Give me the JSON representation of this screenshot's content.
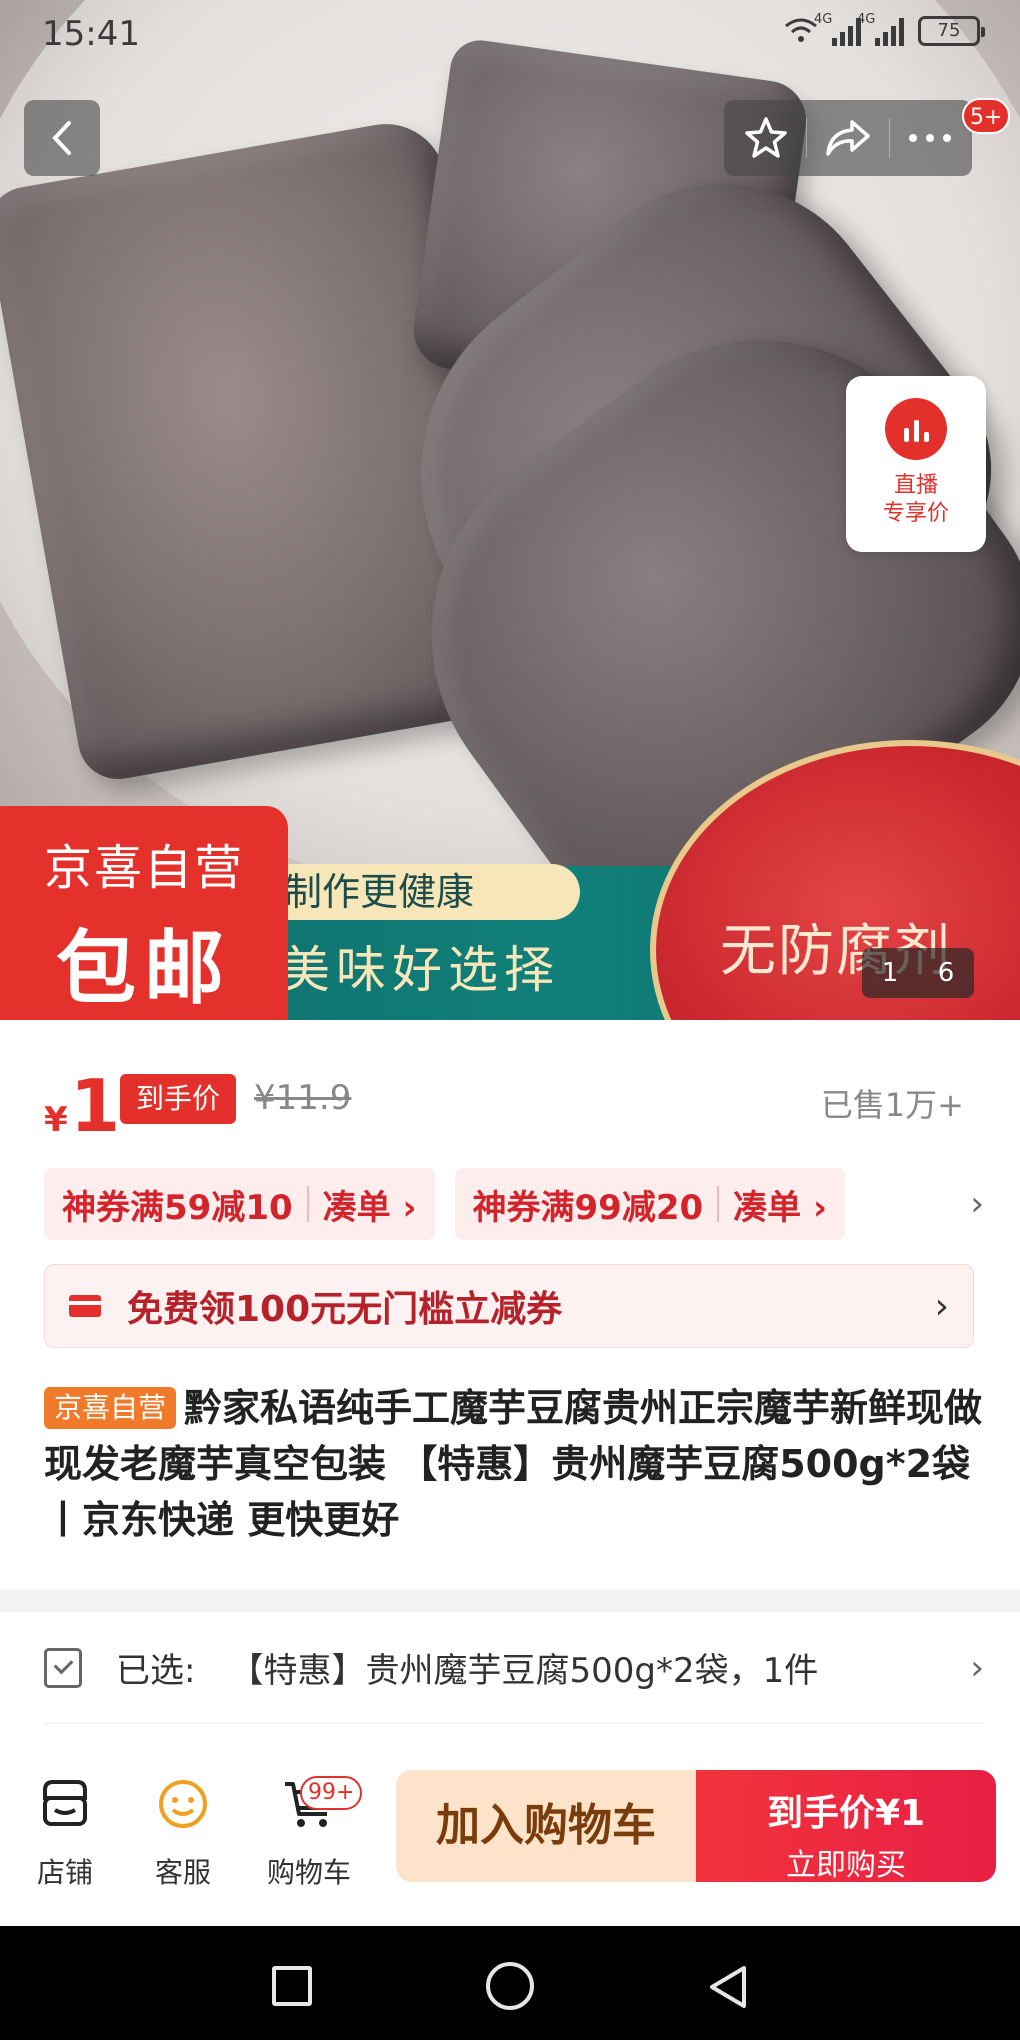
{
  "status_bar": {
    "time": "15:41",
    "network1": "4G",
    "network2": "4G",
    "battery": "75"
  },
  "header": {
    "message_badge": "5+"
  },
  "gallery": {
    "live_card_line1": "直播",
    "live_card_line2": "专享价",
    "badge_line1": "京喜自营",
    "badge_line2": "包邮",
    "banner_line1": "制作更健康",
    "banner_line2": "美味好选择",
    "banner_right": "无防腐剂",
    "counter_current": "1",
    "counter_total": "6"
  },
  "price": {
    "currency": "¥",
    "amount": "1",
    "tag": "到手价",
    "original": "¥11.9",
    "sold": "已售1万+"
  },
  "coupons": [
    {
      "text": "神券满59减10",
      "action": "凑单 ›"
    },
    {
      "text": "神券满99减20",
      "action": "凑单 ›"
    }
  ],
  "coupon_more": "›",
  "promo": {
    "text": "免费领100元无门槛立减券",
    "chevron": "›"
  },
  "product": {
    "self_tag": "京喜自营",
    "title": "黔家私语纯手工魔芋豆腐贵州正宗魔芋新鲜现做现发老魔芋真空包装 【特惠】贵州魔芋豆腐500g*2袋丨京东快递 更快更好"
  },
  "selected": {
    "label": "已选:",
    "value": "【特惠】贵州魔芋豆腐500g*2袋，1件",
    "chevron": "›"
  },
  "bottom_bar": {
    "store": "店铺",
    "service": "客服",
    "cart": "购物车",
    "cart_badge": "99+",
    "add_to_cart": "加入购物车",
    "buy_line1": "到手价¥1",
    "buy_line2": "立即购买"
  },
  "colors": {
    "accent": "#e4302b",
    "orange_tag": "#f07a2a",
    "cart_button": "#fde3c9",
    "buy_button": "#f2333b"
  }
}
